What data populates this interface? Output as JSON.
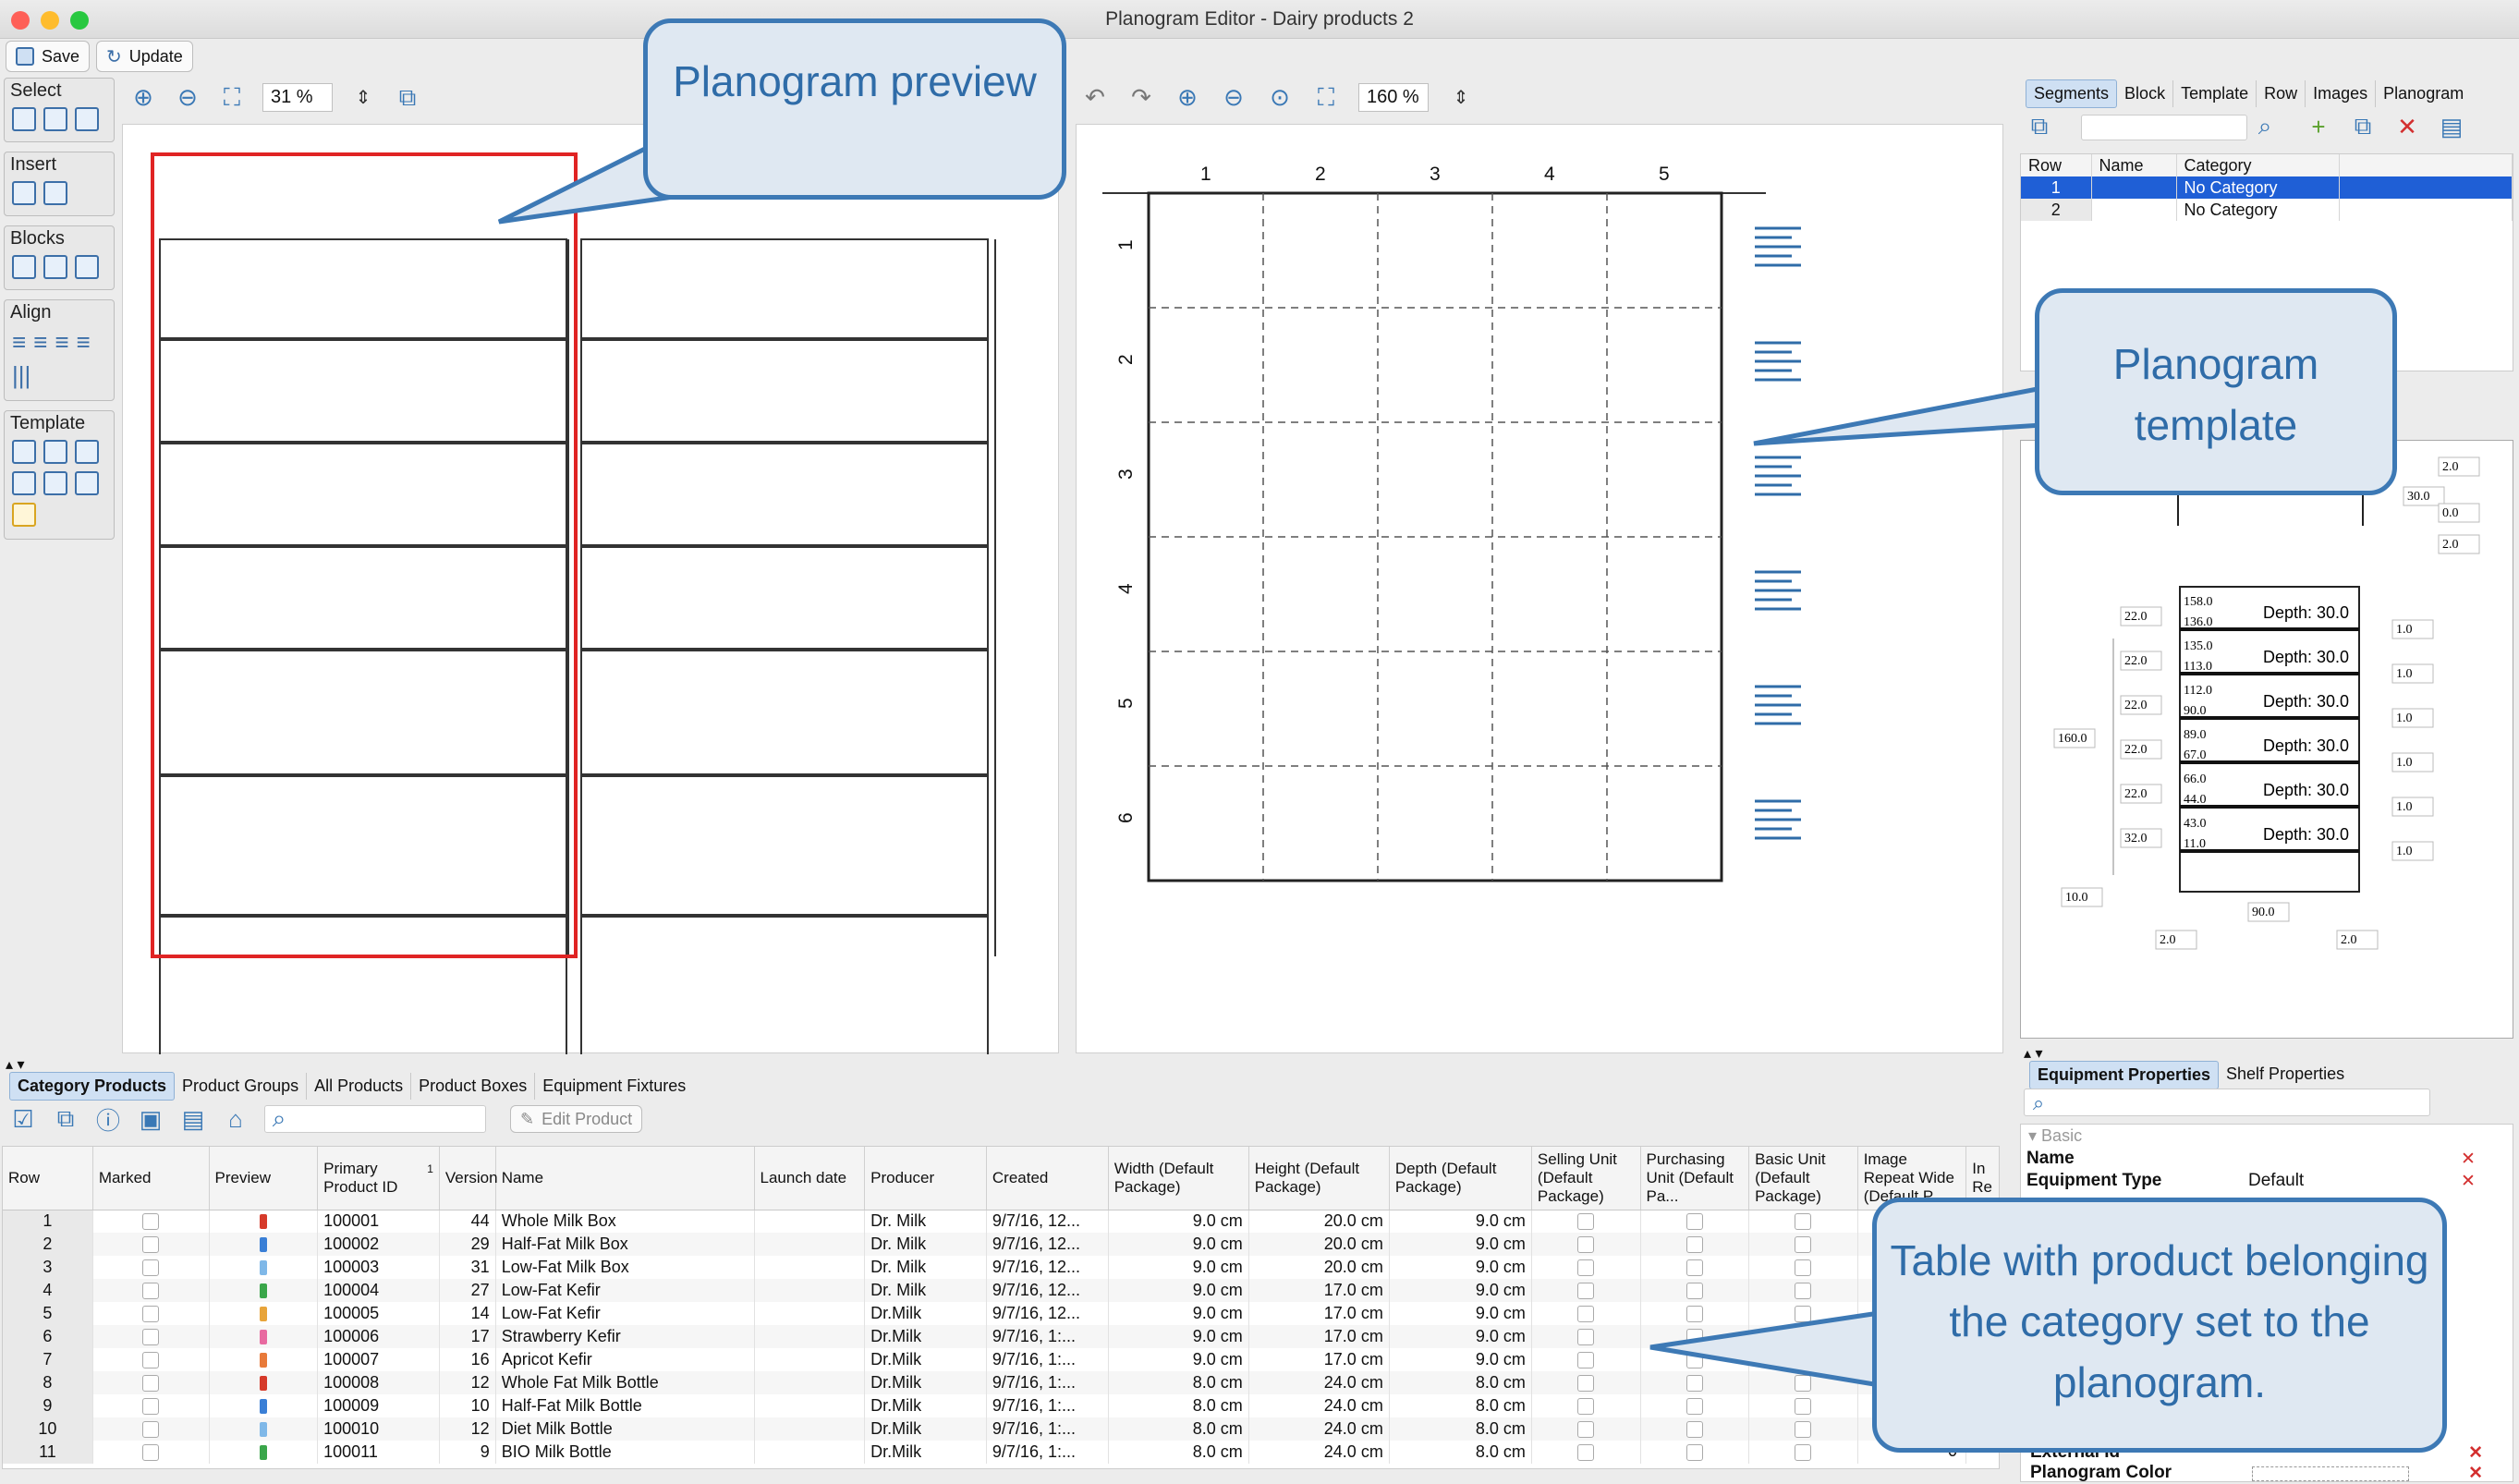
{
  "window": {
    "title": "Planogram Editor - Dairy products 2"
  },
  "toolbar": {
    "save_label": "Save",
    "update_label": "Update"
  },
  "palette": {
    "select": "Select",
    "insert": "Insert",
    "blocks": "Blocks",
    "align": "Align",
    "template": "Template"
  },
  "preview": {
    "zoom": "31 %"
  },
  "template_view": {
    "zoom": "160 %",
    "columns": [
      "1",
      "2",
      "3",
      "4",
      "5"
    ],
    "rows": [
      "1",
      "2",
      "3",
      "4",
      "5",
      "6"
    ]
  },
  "right_tabs": [
    "Segments",
    "Block",
    "Template",
    "Row",
    "Images",
    "Planogram"
  ],
  "segments": {
    "headers": [
      "Row",
      "Name",
      "Category"
    ],
    "rows": [
      {
        "row": "1",
        "name": "",
        "category": "No Category"
      },
      {
        "row": "2",
        "name": "",
        "category": "No Category"
      }
    ]
  },
  "shelf_diagram": {
    "top_labels": [
      "2.0",
      "30.0",
      "0.0",
      "2.0"
    ],
    "left_gaps": [
      "22.0",
      "22.0",
      "22.0",
      "22.0",
      "22.0",
      "32.0"
    ],
    "total_height": "160.0",
    "offset": "10.0",
    "width": "90.0",
    "side_l": "2.0",
    "side_r": "2.0",
    "depth_label": "Depth: 30.0",
    "right_gaps": [
      "1.0",
      "1.0",
      "1.0",
      "1.0",
      "1.0",
      "1.0"
    ],
    "shelves": [
      [
        "158.0",
        "136.0"
      ],
      [
        "135.0",
        "113.0"
      ],
      [
        "112.0",
        "90.0"
      ],
      [
        "89.0",
        "67.0"
      ],
      [
        "66.0",
        "44.0"
      ],
      [
        "43.0",
        "11.0"
      ]
    ]
  },
  "bottom_tabs": [
    "Category Products",
    "Product Groups",
    "All Products",
    "Product Boxes",
    "Equipment Fixtures"
  ],
  "edit_product": "Edit Product",
  "table": {
    "headers": [
      "Row",
      "Marked",
      "Preview",
      "Primary Product ID",
      "Version",
      "Name",
      "Launch date",
      "Producer",
      "Created",
      "Width (Default Package)",
      "Height (Default Package)",
      "Depth (Default Package)",
      "Selling Unit (Default Package)",
      "Purchasing Unit (Default Pa...",
      "Basic Unit (Default Package)",
      "Image Repeat Wide (Default P...",
      "In Re"
    ],
    "sort_mark": "1",
    "rows": [
      [
        "1",
        "100001",
        "44",
        "Whole Milk Box",
        "Dr. Milk",
        "9/7/16, 12...",
        "9.0 cm",
        "20.0 cm",
        "9.0 cm",
        "#d63a2a"
      ],
      [
        "2",
        "100002",
        "29",
        "Half-Fat Milk Box",
        "Dr. Milk",
        "9/7/16, 12...",
        "9.0 cm",
        "20.0 cm",
        "9.0 cm",
        "#3a7fd6"
      ],
      [
        "3",
        "100003",
        "31",
        "Low-Fat Milk Box",
        "Dr. Milk",
        "9/7/16, 12...",
        "9.0 cm",
        "20.0 cm",
        "9.0 cm",
        "#7fb8e8"
      ],
      [
        "4",
        "100004",
        "27",
        "Low-Fat Kefir",
        "Dr. Milk",
        "9/7/16, 12...",
        "9.0 cm",
        "17.0 cm",
        "9.0 cm",
        "#3aa64a"
      ],
      [
        "5",
        "100005",
        "14",
        "Low-Fat Kefir",
        "Dr.Milk",
        "9/7/16, 12...",
        "9.0 cm",
        "17.0 cm",
        "9.0 cm",
        "#e8a43a"
      ],
      [
        "6",
        "100006",
        "17",
        "Strawberry Kefir",
        "Dr.Milk",
        "9/7/16, 1:...",
        "9.0 cm",
        "17.0 cm",
        "9.0 cm",
        "#e86aa0"
      ],
      [
        "7",
        "100007",
        "16",
        "Apricot Kefir",
        "Dr.Milk",
        "9/7/16, 1:...",
        "9.0 cm",
        "17.0 cm",
        "9.0 cm",
        "#e87a3a"
      ],
      [
        "8",
        "100008",
        "12",
        "Whole Fat Milk Bottle",
        "Dr.Milk",
        "9/7/16, 1:...",
        "8.0 cm",
        "24.0 cm",
        "8.0 cm",
        "#d63a2a"
      ],
      [
        "9",
        "100009",
        "10",
        "Half-Fat Milk Bottle",
        "Dr.Milk",
        "9/7/16, 1:...",
        "8.0 cm",
        "24.0 cm",
        "8.0 cm",
        "#3a7fd6"
      ],
      [
        "10",
        "100010",
        "12",
        "Diet Milk Bottle",
        "Dr.Milk",
        "9/7/16, 1:...",
        "8.0 cm",
        "24.0 cm",
        "8.0 cm",
        "#7fb8e8"
      ],
      [
        "11",
        "100011",
        "9",
        "BIO Milk Bottle",
        "Dr.Milk",
        "9/7/16, 1:...",
        "8.0 cm",
        "24.0 cm",
        "8.0 cm",
        "#3aa64a"
      ]
    ]
  },
  "props_tabs": [
    "Equipment Properties",
    "Shelf Properties"
  ],
  "props": {
    "section": "Basic",
    "rows": [
      {
        "k": "Name",
        "v": ""
      },
      {
        "k": "Equipment Type",
        "v": "Default"
      }
    ],
    "bottom": [
      {
        "k": "External Id",
        "v": ""
      },
      {
        "k": "Planogram Color",
        "v": ""
      }
    ],
    "trailing_value": "0"
  },
  "callouts": {
    "preview": "Planogram preview",
    "template": "Planogram template",
    "table": "Table with product belonging the category set to the planogram."
  },
  "colors": {
    "accent": "#3d79b5",
    "selection": "#1f5fd6",
    "preview_red": "#e02424"
  }
}
